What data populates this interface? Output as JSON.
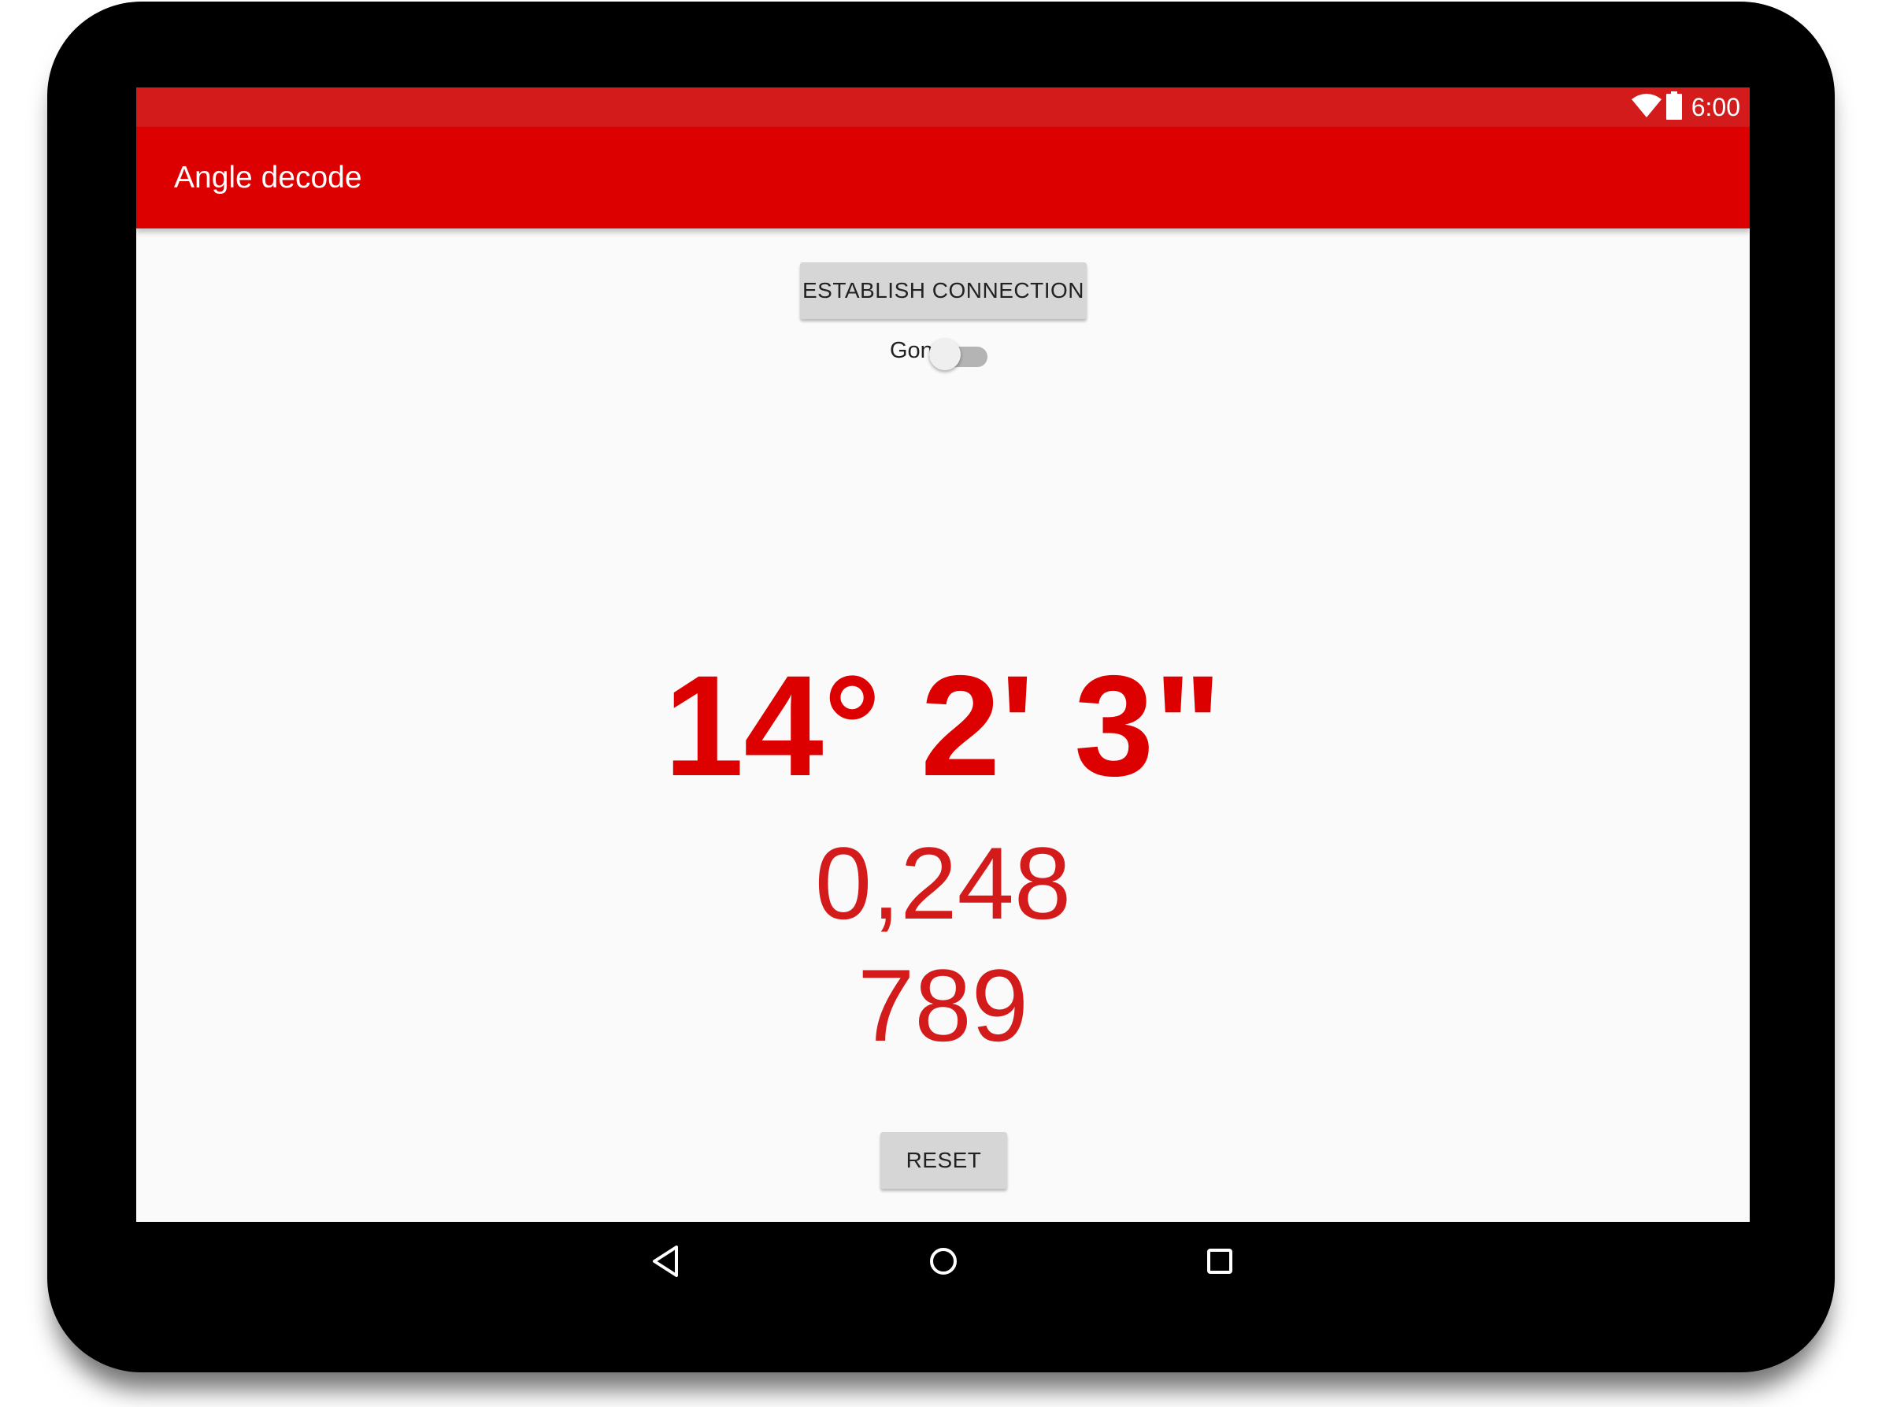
{
  "status_bar": {
    "time": "6:00",
    "icons": [
      "wifi-icon",
      "battery-icon"
    ]
  },
  "app_bar": {
    "title": "Angle decode"
  },
  "main": {
    "connect_button_label": "ESTABLISH CONNECTION",
    "toggle": {
      "label": "Gon",
      "checked": false
    },
    "angle_dms": "14° 2' 3\"",
    "value_primary": "0,248",
    "value_secondary": "789",
    "reset_button_label": "RESET"
  },
  "nav_bar": {
    "icons": [
      "back-icon",
      "home-icon",
      "recents-icon"
    ]
  },
  "colors": {
    "primary": "#dd0000",
    "status_bar": "#d41b1b",
    "background": "#fafafa"
  }
}
